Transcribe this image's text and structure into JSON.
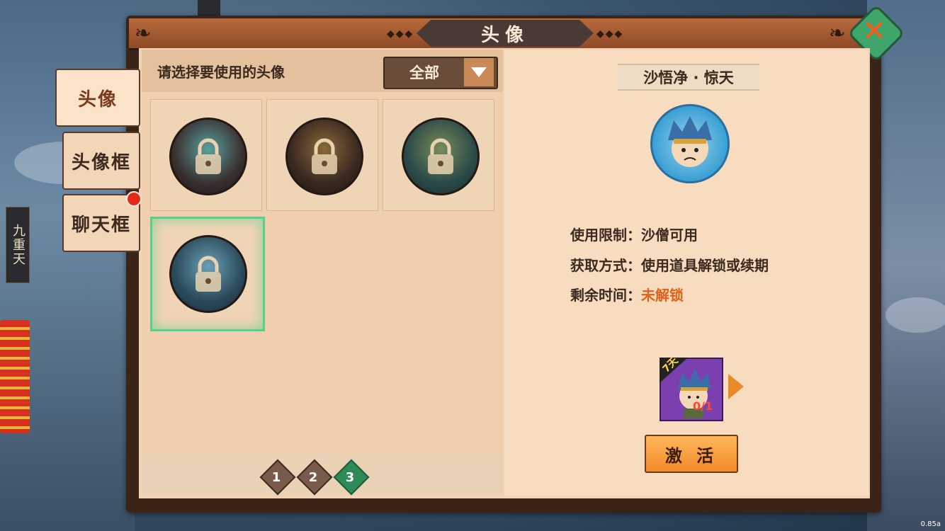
{
  "background": {
    "side_label": "九重天"
  },
  "panel": {
    "title": "头像"
  },
  "side_tabs": [
    {
      "label": "头像",
      "active": true
    },
    {
      "label": "头像框",
      "active": false
    },
    {
      "label": "聊天框",
      "active": false,
      "badge": true
    }
  ],
  "left": {
    "prompt": "请选择要使用的头像",
    "filter_value": "全部",
    "slots": [
      {
        "name": "avatar-1",
        "locked": true,
        "selected": false
      },
      {
        "name": "avatar-2",
        "locked": true,
        "selected": false
      },
      {
        "name": "avatar-3",
        "locked": true,
        "selected": false
      },
      {
        "name": "avatar-4",
        "locked": true,
        "selected": true
      }
    ],
    "pages": [
      "1",
      "2",
      "3"
    ],
    "current_page": "3"
  },
  "right": {
    "avatar_name": "沙悟净 · 惊天",
    "usage_label": "使用限制：",
    "usage_value": "沙僧可用",
    "obtain_label": "获取方式：",
    "obtain_value": "使用道具解锁或续期",
    "remain_label": "剩余时间：",
    "remain_value": "未解锁",
    "item_tag": "7天",
    "item_count": "0/1",
    "activate_label": "激 活"
  },
  "version": "0.85a",
  "colors": {
    "accent_green": "#57d08a",
    "warning_orange": "#e0621a",
    "button_orange": "#f28a2a"
  }
}
